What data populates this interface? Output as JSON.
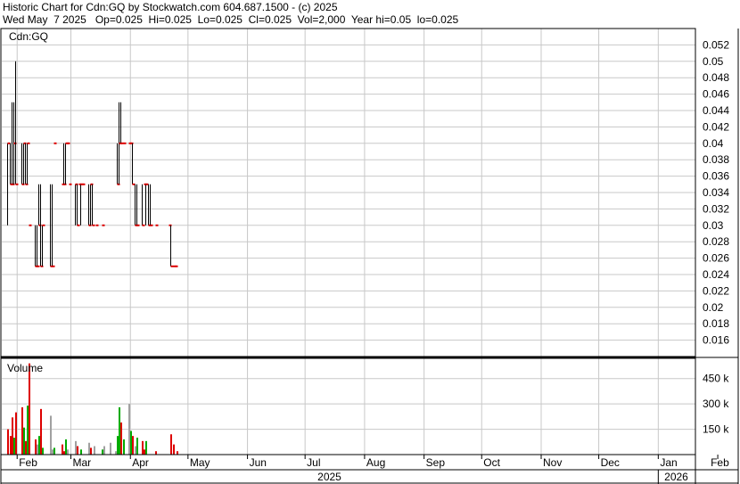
{
  "header": {
    "line1": "Historic Chart for Cdn:GQ by Stockwatch.com 604.687.1500 - (c) 2025",
    "line2": "Wed May  7 2025   Op=0.025  Hi=0.025  Lo=0.025  Cl=0.025  Vol=2,000  Year hi=0.05  lo=0.025"
  },
  "chart_data": [
    {
      "type": "ohlc",
      "title": "Cdn:GQ",
      "ylim": [
        0.014,
        0.054
      ],
      "y_ticks": [
        "0.052",
        "0.05",
        "0.048",
        "0.046",
        "0.044",
        "0.042",
        "0.04",
        "0.038",
        "0.036",
        "0.034",
        "0.032",
        "0.03",
        "0.028",
        "0.026",
        "0.024",
        "0.022",
        "0.02",
        "0.018",
        "0.016"
      ],
      "x_ticks": [
        "Feb",
        "Mar",
        "Apr",
        "May",
        "Jun",
        "Jul",
        "Aug",
        "Sep",
        "Oct",
        "Nov",
        "Dec",
        "Jan",
        "Feb"
      ],
      "year_labels": [
        "2025",
        "2026"
      ],
      "grid": true,
      "bars": [
        {
          "date": "2025-01-27",
          "h": 0.04,
          "l": 0.03,
          "c": 0.04
        },
        {
          "date": "2025-01-28",
          "h": 0.04,
          "l": 0.035,
          "c": 0.035
        },
        {
          "date": "2025-01-29",
          "h": 0.045,
          "l": 0.035,
          "c": 0.035
        },
        {
          "date": "2025-01-30",
          "h": 0.045,
          "l": 0.035,
          "c": 0.04
        },
        {
          "date": "2025-01-31",
          "h": 0.05,
          "l": 0.035,
          "c": 0.035
        },
        {
          "date": "2025-02-03",
          "h": 0.04,
          "l": 0.035,
          "c": 0.035
        },
        {
          "date": "2025-02-04",
          "h": 0.04,
          "l": 0.035,
          "c": 0.04
        },
        {
          "date": "2025-02-05",
          "h": 0.04,
          "l": 0.035,
          "c": 0.035
        },
        {
          "date": "2025-02-06",
          "h": 0.04,
          "l": 0.035,
          "c": 0.04
        },
        {
          "date": "2025-02-07",
          "h": 0.03,
          "l": 0.03,
          "c": 0.03
        },
        {
          "date": "2025-02-10",
          "h": 0.03,
          "l": 0.025,
          "c": 0.025
        },
        {
          "date": "2025-02-11",
          "h": 0.03,
          "l": 0.025,
          "c": 0.025
        },
        {
          "date": "2025-02-12",
          "h": 0.035,
          "l": 0.03,
          "c": 0.03
        },
        {
          "date": "2025-02-13",
          "h": 0.035,
          "l": 0.025,
          "c": 0.025
        },
        {
          "date": "2025-02-14",
          "h": 0.03,
          "l": 0.025,
          "c": 0.03
        },
        {
          "date": "2025-02-18",
          "h": 0.035,
          "l": 0.025,
          "c": 0.025
        },
        {
          "date": "2025-02-19",
          "h": 0.035,
          "l": 0.025,
          "c": 0.025
        },
        {
          "date": "2025-02-20",
          "h": 0.04,
          "l": 0.04,
          "c": 0.04
        },
        {
          "date": "2025-02-24",
          "h": 0.035,
          "l": 0.035,
          "c": 0.035
        },
        {
          "date": "2025-02-25",
          "h": 0.04,
          "l": 0.035,
          "c": 0.035
        },
        {
          "date": "2025-02-26",
          "h": 0.04,
          "l": 0.035,
          "c": 0.04
        },
        {
          "date": "2025-02-27",
          "h": 0.04,
          "l": 0.04,
          "c": 0.04
        },
        {
          "date": "2025-02-28",
          "h": 0.035,
          "l": 0.035,
          "c": 0.035
        },
        {
          "date": "2025-03-03",
          "h": 0.035,
          "l": 0.03,
          "c": 0.035
        },
        {
          "date": "2025-03-04",
          "h": 0.035,
          "l": 0.03,
          "c": 0.03
        },
        {
          "date": "2025-03-05",
          "h": 0.035,
          "l": 0.035,
          "c": 0.035
        },
        {
          "date": "2025-03-06",
          "h": 0.035,
          "l": 0.03,
          "c": 0.035
        },
        {
          "date": "2025-03-07",
          "h": 0.035,
          "l": 0.035,
          "c": 0.035
        },
        {
          "date": "2025-03-10",
          "h": 0.035,
          "l": 0.03,
          "c": 0.03
        },
        {
          "date": "2025-03-11",
          "h": 0.035,
          "l": 0.03,
          "c": 0.035
        },
        {
          "date": "2025-03-12",
          "h": 0.035,
          "l": 0.03,
          "c": 0.03
        },
        {
          "date": "2025-03-14",
          "h": 0.03,
          "l": 0.03,
          "c": 0.03
        },
        {
          "date": "2025-03-17",
          "h": 0.03,
          "l": 0.03,
          "c": 0.03
        },
        {
          "date": "2025-03-25",
          "h": 0.04,
          "l": 0.035,
          "c": 0.035
        },
        {
          "date": "2025-03-26",
          "h": 0.045,
          "l": 0.035,
          "c": 0.04
        },
        {
          "date": "2025-03-27",
          "h": 0.045,
          "l": 0.04,
          "c": 0.04
        },
        {
          "date": "2025-03-28",
          "h": 0.04,
          "l": 0.04,
          "c": 0.04
        },
        {
          "date": "2025-03-31",
          "h": 0.04,
          "l": 0.04,
          "c": 0.04
        },
        {
          "date": "2025-04-01",
          "h": 0.04,
          "l": 0.04,
          "c": 0.04
        },
        {
          "date": "2025-04-02",
          "h": 0.04,
          "l": 0.035,
          "c": 0.035
        },
        {
          "date": "2025-04-03",
          "h": 0.035,
          "l": 0.03,
          "c": 0.03
        },
        {
          "date": "2025-04-04",
          "h": 0.035,
          "l": 0.03,
          "c": 0.03
        },
        {
          "date": "2025-04-07",
          "h": 0.035,
          "l": 0.03,
          "c": 0.03
        },
        {
          "date": "2025-04-08",
          "h": 0.035,
          "l": 0.035,
          "c": 0.035
        },
        {
          "date": "2025-04-09",
          "h": 0.035,
          "l": 0.03,
          "c": 0.035
        },
        {
          "date": "2025-04-10",
          "h": 0.035,
          "l": 0.03,
          "c": 0.03
        },
        {
          "date": "2025-04-11",
          "h": 0.035,
          "l": 0.03,
          "c": 0.03
        },
        {
          "date": "2025-04-14",
          "h": 0.03,
          "l": 0.03,
          "c": 0.03
        },
        {
          "date": "2025-04-21",
          "h": 0.03,
          "l": 0.03,
          "c": 0.03
        },
        {
          "date": "2025-04-22",
          "h": 0.03,
          "l": 0.025,
          "c": 0.025
        },
        {
          "date": "2025-04-23",
          "h": 0.025,
          "l": 0.025,
          "c": 0.025
        },
        {
          "date": "2025-04-24",
          "h": 0.025,
          "l": 0.025,
          "c": 0.025
        }
      ]
    },
    {
      "type": "bar",
      "title": "Volume",
      "ylim": [
        0,
        570000
      ],
      "y_ticks": [
        "450 k",
        "300 k",
        "150 k"
      ],
      "colors": {
        "up": "#00aa00",
        "down": "#dd0000",
        "flat": "#a0a0a0"
      },
      "bars": [
        {
          "date": "2025-01-27",
          "v": 150000,
          "dir": "down"
        },
        {
          "date": "2025-01-28",
          "v": 110000,
          "dir": "down"
        },
        {
          "date": "2025-01-29",
          "v": 220000,
          "dir": "down"
        },
        {
          "date": "2025-01-30",
          "v": 100000,
          "dir": "up"
        },
        {
          "date": "2025-01-31",
          "v": 250000,
          "dir": "down"
        },
        {
          "date": "2025-02-03",
          "v": 280000,
          "dir": "down"
        },
        {
          "date": "2025-02-04",
          "v": 160000,
          "dir": "up"
        },
        {
          "date": "2025-02-05",
          "v": 80000,
          "dir": "down"
        },
        {
          "date": "2025-02-06",
          "v": 290000,
          "dir": "up"
        },
        {
          "date": "2025-02-07",
          "v": 540000,
          "dir": "down"
        },
        {
          "date": "2025-02-10",
          "v": 90000,
          "dir": "down"
        },
        {
          "date": "2025-02-11",
          "v": 60000,
          "dir": "flat"
        },
        {
          "date": "2025-02-12",
          "v": 110000,
          "dir": "up"
        },
        {
          "date": "2025-02-13",
          "v": 270000,
          "dir": "down"
        },
        {
          "date": "2025-02-14",
          "v": 40000,
          "dir": "up"
        },
        {
          "date": "2025-02-18",
          "v": 230000,
          "dir": "flat"
        },
        {
          "date": "2025-02-19",
          "v": 30000,
          "dir": "flat"
        },
        {
          "date": "2025-02-20",
          "v": 40000,
          "dir": "up"
        },
        {
          "date": "2025-02-24",
          "v": 60000,
          "dir": "down"
        },
        {
          "date": "2025-02-25",
          "v": 20000,
          "dir": "down"
        },
        {
          "date": "2025-02-26",
          "v": 90000,
          "dir": "up"
        },
        {
          "date": "2025-02-27",
          "v": 30000,
          "dir": "flat"
        },
        {
          "date": "2025-03-03",
          "v": 80000,
          "dir": "flat"
        },
        {
          "date": "2025-03-04",
          "v": 50000,
          "dir": "down"
        },
        {
          "date": "2025-03-06",
          "v": 30000,
          "dir": "up"
        },
        {
          "date": "2025-03-10",
          "v": 70000,
          "dir": "flat"
        },
        {
          "date": "2025-03-11",
          "v": 40000,
          "dir": "down"
        },
        {
          "date": "2025-03-13",
          "v": 50000,
          "dir": "flat"
        },
        {
          "date": "2025-03-17",
          "v": 30000,
          "dir": "up"
        },
        {
          "date": "2025-03-18",
          "v": 50000,
          "dir": "flat"
        },
        {
          "date": "2025-03-21",
          "v": 70000,
          "dir": "flat"
        },
        {
          "date": "2025-03-24",
          "v": 20000,
          "dir": "flat"
        },
        {
          "date": "2025-03-25",
          "v": 110000,
          "dir": "up"
        },
        {
          "date": "2025-03-26",
          "v": 280000,
          "dir": "up"
        },
        {
          "date": "2025-03-27",
          "v": 190000,
          "dir": "down"
        },
        {
          "date": "2025-03-28",
          "v": 90000,
          "dir": "up"
        },
        {
          "date": "2025-03-31",
          "v": 300000,
          "dir": "flat"
        },
        {
          "date": "2025-04-01",
          "v": 140000,
          "dir": "up"
        },
        {
          "date": "2025-04-02",
          "v": 110000,
          "dir": "down"
        },
        {
          "date": "2025-04-03",
          "v": 50000,
          "dir": "flat"
        },
        {
          "date": "2025-04-04",
          "v": 100000,
          "dir": "up"
        },
        {
          "date": "2025-04-07",
          "v": 80000,
          "dir": "down"
        },
        {
          "date": "2025-04-08",
          "v": 30000,
          "dir": "down"
        },
        {
          "date": "2025-04-09",
          "v": 80000,
          "dir": "up"
        },
        {
          "date": "2025-04-14",
          "v": 20000,
          "dir": "down"
        },
        {
          "date": "2025-04-22",
          "v": 120000,
          "dir": "down"
        },
        {
          "date": "2025-04-23",
          "v": 60000,
          "dir": "down"
        },
        {
          "date": "2025-04-25",
          "v": 20000,
          "dir": "down"
        }
      ]
    }
  ]
}
